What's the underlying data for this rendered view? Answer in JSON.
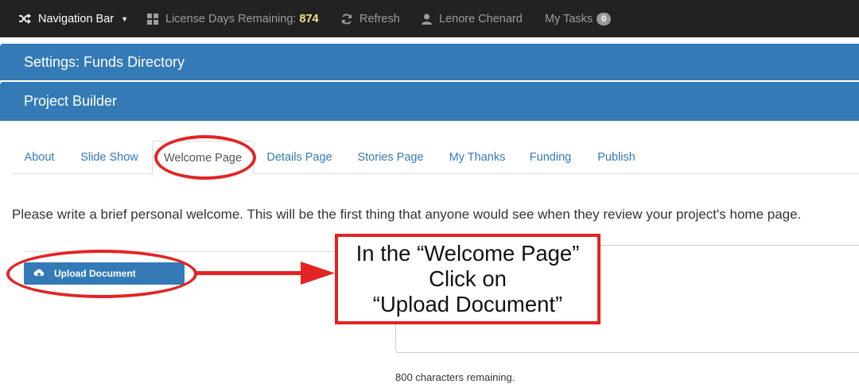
{
  "navbar": {
    "brand": "Navigation Bar",
    "license_label": "License Days Remaining:",
    "license_days": "874",
    "refresh_label": "Refresh",
    "user_name": "Lenore Chenard",
    "tasks_label": "My Tasks",
    "tasks_count": "0",
    "icons": [
      "shuffle-icon",
      "caret-down-icon",
      "grid-icon",
      "refresh-icon",
      "user-icon"
    ]
  },
  "headers": {
    "settings_title": "Settings: Funds Directory",
    "builder_title": "Project Builder"
  },
  "tabs": [
    {
      "label": "About",
      "active": false
    },
    {
      "label": "Slide Show",
      "active": false
    },
    {
      "label": "Welcome Page",
      "active": true
    },
    {
      "label": "Details Page",
      "active": false
    },
    {
      "label": "Stories Page",
      "active": false
    },
    {
      "label": "My Thanks",
      "active": false
    },
    {
      "label": "Funding",
      "active": false
    },
    {
      "label": "Publish",
      "active": false
    }
  ],
  "main": {
    "instruction": "Please write a brief personal welcome. This will be the first thing that anyone would see when they review your project's home page.",
    "upload_button": "Upload Document",
    "upload_icon": "cloud-upload-icon",
    "textarea_value": "",
    "chars_remaining": "800 characters remaining."
  },
  "annotation": {
    "line1": "In the “Welcome Page”",
    "line2": "Click on",
    "line3": "“Upload Document”",
    "color": "#e32424"
  },
  "colors": {
    "navbar_bg": "#222222",
    "primary": "#337ab7",
    "license_number": "#f0e68c"
  }
}
